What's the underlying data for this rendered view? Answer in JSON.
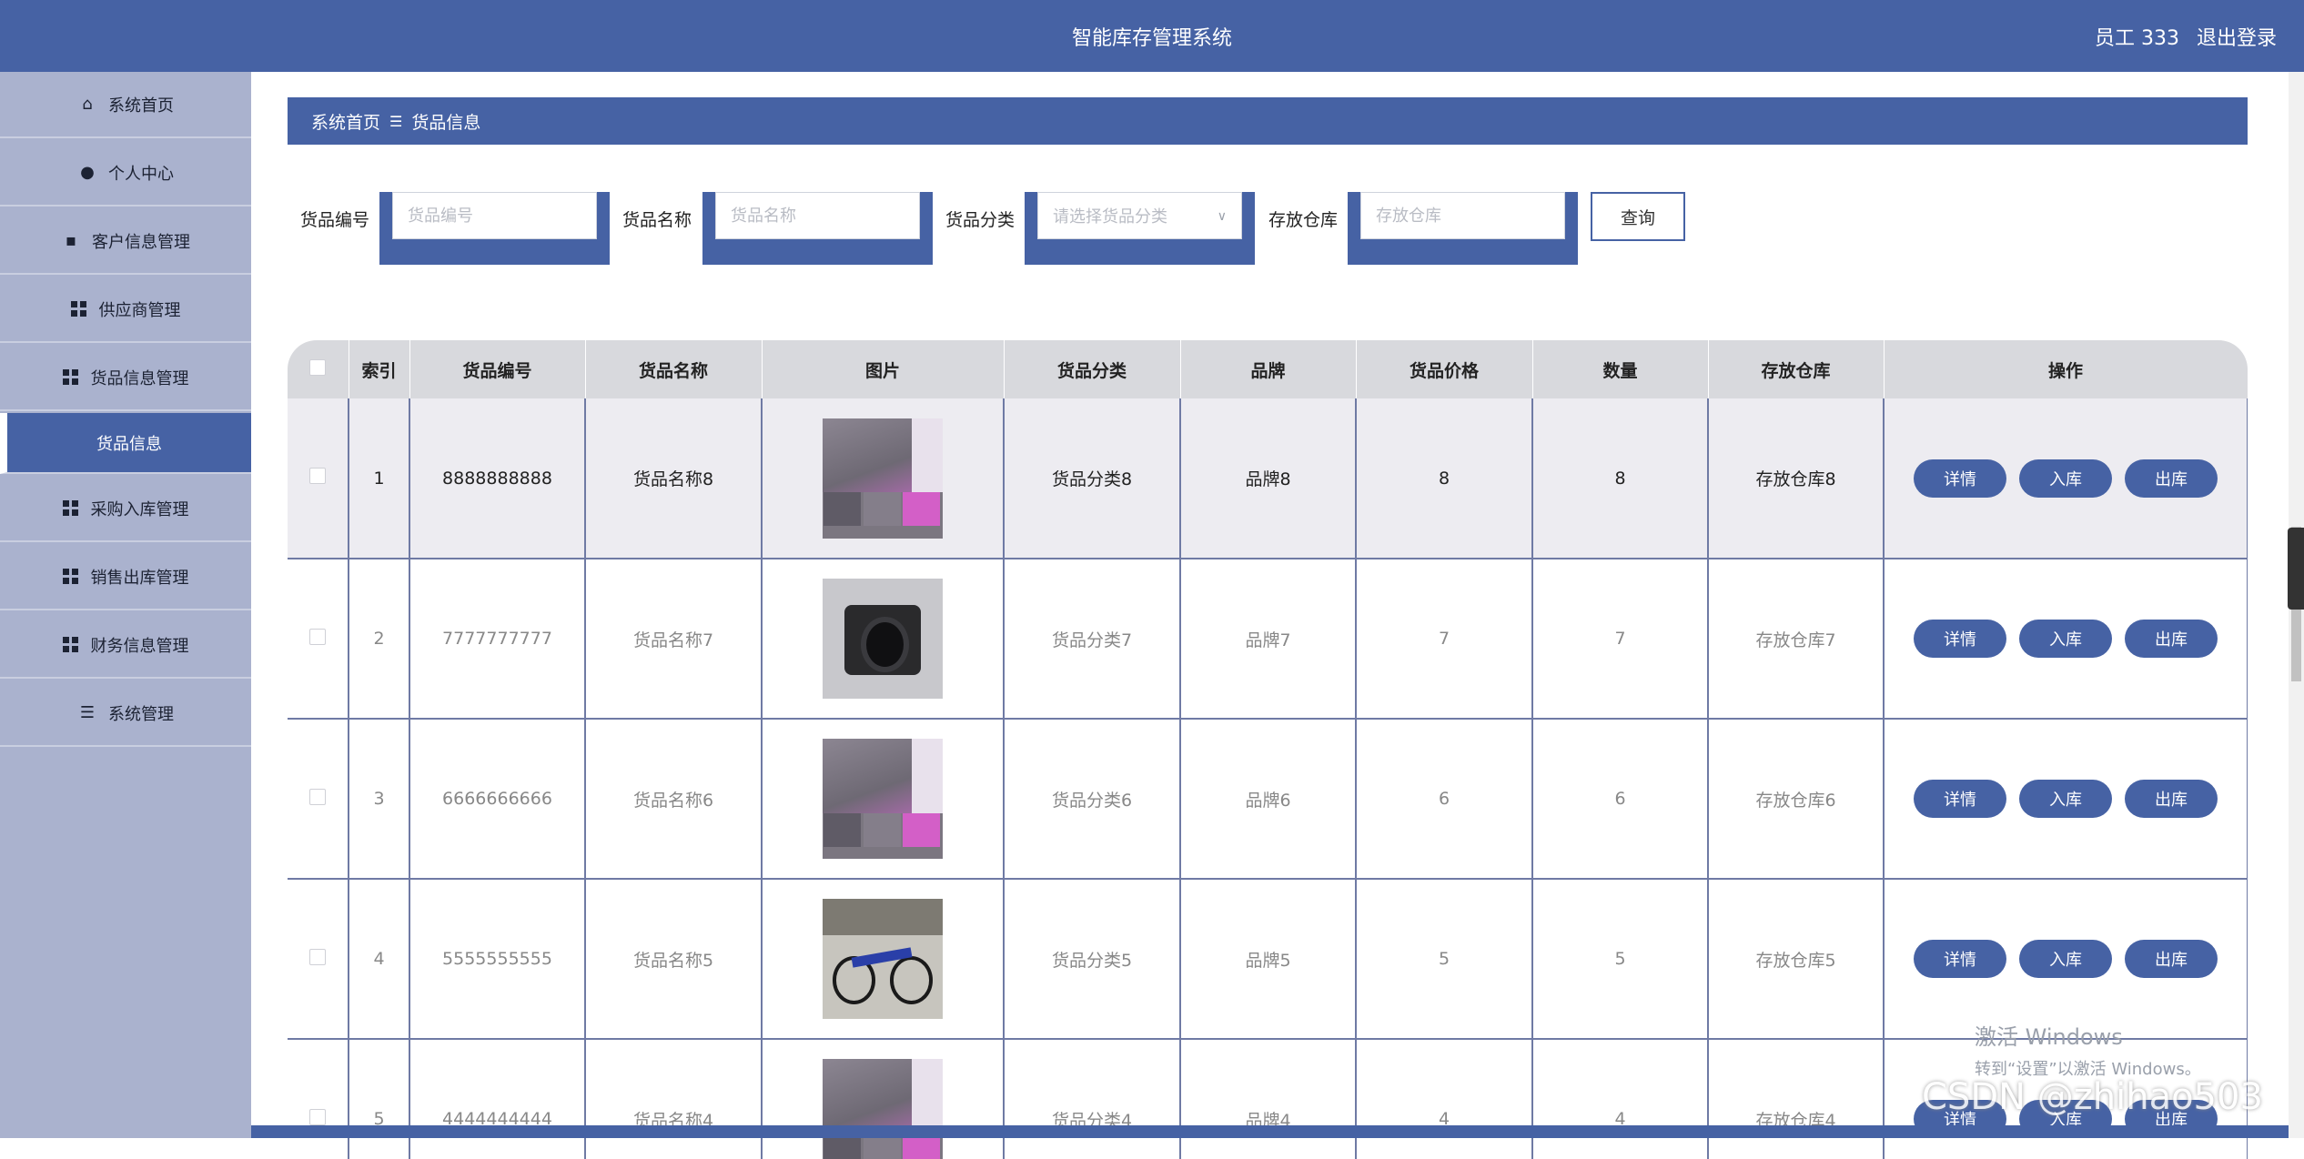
{
  "header": {
    "title": "智能库存管理系统",
    "user": "员工 333",
    "logout": "退出登录"
  },
  "sidebar": {
    "items": [
      {
        "label": "系统首页",
        "icon": "home-icon"
      },
      {
        "label": "个人中心",
        "icon": "user-icon"
      },
      {
        "label": "客户信息管理",
        "icon": "chat-icon"
      },
      {
        "label": "供应商管理",
        "icon": "grid-icon"
      },
      {
        "label": "货品信息管理",
        "icon": "grid-icon"
      },
      {
        "label": "货品信息",
        "icon": "",
        "active": true
      },
      {
        "label": "采购入库管理",
        "icon": "grid-icon"
      },
      {
        "label": "销售出库管理",
        "icon": "grid-icon"
      },
      {
        "label": "财务信息管理",
        "icon": "grid-icon"
      },
      {
        "label": "系统管理",
        "icon": "menu-icon"
      }
    ]
  },
  "breadcrumb": {
    "home": "系统首页",
    "sep": "☰",
    "current": "货品信息"
  },
  "search": {
    "code_label": "货品编号",
    "code_placeholder": "货品编号",
    "name_label": "货品名称",
    "name_placeholder": "货品名称",
    "category_label": "货品分类",
    "category_placeholder": "请选择货品分类",
    "warehouse_label": "存放仓库",
    "warehouse_placeholder": "存放仓库",
    "query_button": "查询"
  },
  "table": {
    "columns": [
      "索引",
      "货品编号",
      "货品名称",
      "图片",
      "货品分类",
      "品牌",
      "货品价格",
      "数量",
      "存放仓库",
      "操作"
    ],
    "action_labels": {
      "detail": "详情",
      "in": "入库",
      "out": "出库"
    },
    "rows": [
      {
        "index": "1",
        "code": "8888888888",
        "name": "货品名称8",
        "image": "bedding",
        "category": "货品分类8",
        "brand": "品牌8",
        "price": "8",
        "qty": "8",
        "warehouse": "存放仓库8"
      },
      {
        "index": "2",
        "code": "7777777777",
        "name": "货品名称7",
        "image": "camera",
        "category": "货品分类7",
        "brand": "品牌7",
        "price": "7",
        "qty": "7",
        "warehouse": "存放仓库7"
      },
      {
        "index": "3",
        "code": "6666666666",
        "name": "货品名称6",
        "image": "bedding",
        "category": "货品分类6",
        "brand": "品牌6",
        "price": "6",
        "qty": "6",
        "warehouse": "存放仓库6"
      },
      {
        "index": "4",
        "code": "5555555555",
        "name": "货品名称5",
        "image": "bicycle",
        "category": "货品分类5",
        "brand": "品牌5",
        "price": "5",
        "qty": "5",
        "warehouse": "存放仓库5"
      },
      {
        "index": "5",
        "code": "4444444444",
        "name": "货品名称4",
        "image": "bedding",
        "category": "货品分类4",
        "brand": "品牌4",
        "price": "4",
        "qty": "4",
        "warehouse": "存放仓库4"
      }
    ]
  },
  "overlay": {
    "watermark_title": "激活 Windows",
    "watermark_sub": "转到“设置”以激活 Windows。",
    "csdn": "CSDN @zhihao503"
  },
  "colors": {
    "primary": "#4662a4",
    "sidebar": "#aab2ce",
    "header_row": "#d8d9dd",
    "highlight_row": "#edecf1"
  }
}
